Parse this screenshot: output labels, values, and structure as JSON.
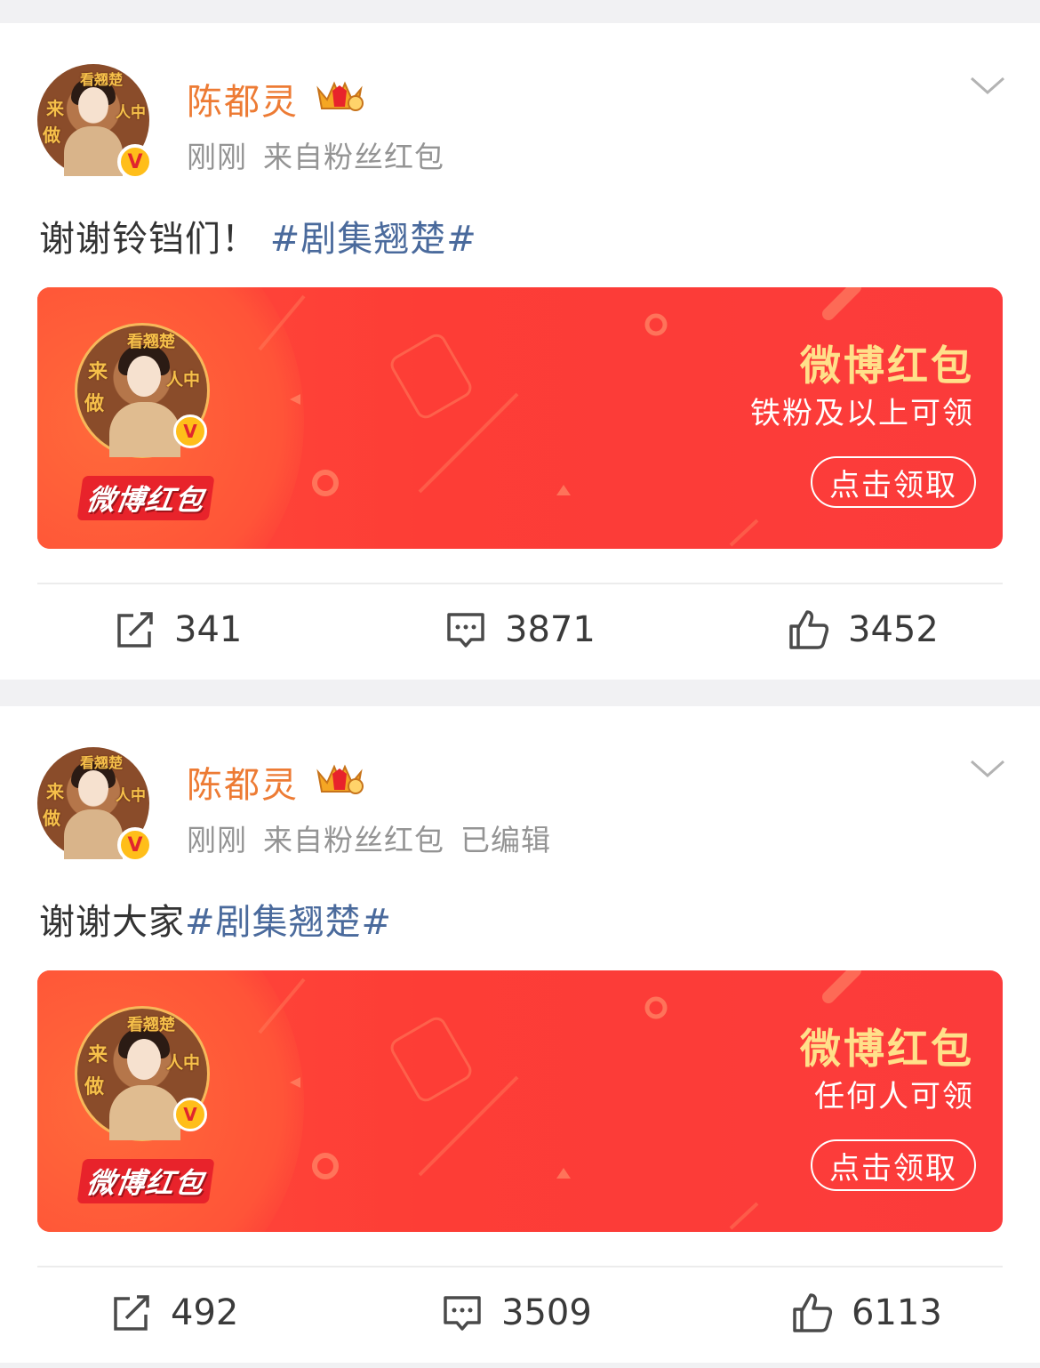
{
  "posts": [
    {
      "username": "陈都灵",
      "time": "刚刚",
      "source": "来自粉丝红包",
      "edited": "",
      "text": "谢谢铃铛们！",
      "hashtag": "#剧集翘楚#",
      "avatar_text": [
        "来",
        "看翘楚",
        "做",
        "人中",
        "翘",
        "楚"
      ],
      "red_packet": {
        "brand": "微博红包",
        "title": "微博红包",
        "subtitle": "铁粉及以上可领",
        "button": "点击领取"
      },
      "reposts": "341",
      "comments": "3871",
      "likes": "3452"
    },
    {
      "username": "陈都灵",
      "time": "刚刚",
      "source": "来自粉丝红包",
      "edited": "已编辑",
      "text": "谢谢大家",
      "hashtag": "#剧集翘楚#",
      "avatar_text": [
        "来",
        "看翘楚",
        "做",
        "人中",
        "翘",
        "楚"
      ],
      "red_packet": {
        "brand": "微博红包",
        "title": "微博红包",
        "subtitle": "任何人可领",
        "button": "点击领取"
      },
      "reposts": "492",
      "comments": "3509",
      "likes": "6113"
    }
  ],
  "colors": {
    "username": "#ed7b34",
    "hashtag": "#4a6a9c",
    "red_packet": "#fb3b3b",
    "red_packet_title": "#ffe08a"
  },
  "icons": {
    "verified": "v-badge-icon",
    "crown": "crown-icon",
    "chevron": "chevron-down-icon",
    "repost": "repost-icon",
    "comment": "comment-icon",
    "like": "like-icon"
  }
}
